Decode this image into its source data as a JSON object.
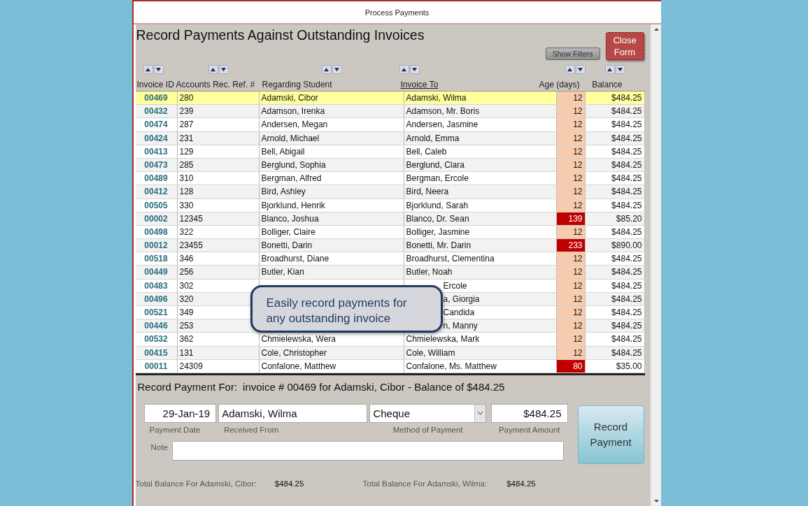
{
  "window": {
    "title": "Process Payments"
  },
  "form_title": "Record Payments Against Outstanding Invoices",
  "buttons": {
    "show_filters": "Show Filters",
    "close_form": "Close Form",
    "record_payment": "Record Payment"
  },
  "table": {
    "columns": [
      {
        "label": "Invoice ID",
        "underlined": false
      },
      {
        "label": "Accounts Rec. Ref. #",
        "underlined": false
      },
      {
        "label": "Regarding Student",
        "underlined": false
      },
      {
        "label": "Invoice To",
        "underlined": true
      },
      {
        "label": "Age (days)",
        "underlined": false
      },
      {
        "label": "Balance",
        "underlined": false
      }
    ],
    "rows": [
      {
        "invoice_id": "00469",
        "ref": "280",
        "student": "Adamski, Cibor",
        "invoice_to": "Adamski, Wilma",
        "age": "12",
        "overdue": false,
        "balance": "$484.25",
        "selected": true
      },
      {
        "invoice_id": "00432",
        "ref": "239",
        "student": "Adamson, Irenka",
        "invoice_to": "Adamson, Mr. Boris",
        "age": "12",
        "overdue": false,
        "balance": "$484.25",
        "selected": false
      },
      {
        "invoice_id": "00474",
        "ref": "287",
        "student": "Andersen, Megan",
        "invoice_to": "Andersen, Jasmine",
        "age": "12",
        "overdue": false,
        "balance": "$484.25",
        "selected": false
      },
      {
        "invoice_id": "00424",
        "ref": "231",
        "student": "Arnold, Michael",
        "invoice_to": "Arnold, Emma",
        "age": "12",
        "overdue": false,
        "balance": "$484.25",
        "selected": false
      },
      {
        "invoice_id": "00413",
        "ref": "129",
        "student": "Bell, Abigail",
        "invoice_to": "Bell, Caleb",
        "age": "12",
        "overdue": false,
        "balance": "$484.25",
        "selected": false
      },
      {
        "invoice_id": "00473",
        "ref": "285",
        "student": "Berglund, Sophia",
        "invoice_to": "Berglund, Clara",
        "age": "12",
        "overdue": false,
        "balance": "$484.25",
        "selected": false
      },
      {
        "invoice_id": "00489",
        "ref": "310",
        "student": "Bergman, Alfred",
        "invoice_to": "Bergman, Ercole",
        "age": "12",
        "overdue": false,
        "balance": "$484.25",
        "selected": false
      },
      {
        "invoice_id": "00412",
        "ref": "128",
        "student": "Bird, Ashley",
        "invoice_to": "Bird, Neera",
        "age": "12",
        "overdue": false,
        "balance": "$484.25",
        "selected": false
      },
      {
        "invoice_id": "00505",
        "ref": "330",
        "student": "Bjorklund, Henrik",
        "invoice_to": "Bjorklund, Sarah",
        "age": "12",
        "overdue": false,
        "balance": "$484.25",
        "selected": false
      },
      {
        "invoice_id": "00002",
        "ref": "12345",
        "student": "Blanco, Joshua",
        "invoice_to": "Blanco, Dr. Sean",
        "age": "139",
        "overdue": true,
        "balance": "$85.20",
        "selected": false
      },
      {
        "invoice_id": "00498",
        "ref": "322",
        "student": "Bolliger, Claire",
        "invoice_to": "Bolliger, Jasmine",
        "age": "12",
        "overdue": false,
        "balance": "$484.25",
        "selected": false
      },
      {
        "invoice_id": "00012",
        "ref": "23455",
        "student": "Bonetti, Darin",
        "invoice_to": "Bonetti, Mr. Darin",
        "age": "233",
        "overdue": true,
        "balance": "$890.00",
        "selected": false
      },
      {
        "invoice_id": "00518",
        "ref": "346",
        "student": "Broadhurst, Diane",
        "invoice_to": "Broadhurst, Clementina",
        "age": "12",
        "overdue": false,
        "balance": "$484.25",
        "selected": false
      },
      {
        "invoice_id": "00449",
        "ref": "256",
        "student": "Butler, Kian",
        "invoice_to": "Butler, Noah",
        "age": "12",
        "overdue": false,
        "balance": "$484.25",
        "selected": false
      },
      {
        "invoice_id": "00483",
        "ref": "302",
        "invoice_to": "Ercole",
        "age": "12",
        "overdue": false,
        "balance": "$484.25",
        "selected": false
      },
      {
        "invoice_id": "00496",
        "ref": "320",
        "invoice_to": "a, Giorgia",
        "age": "12",
        "overdue": false,
        "balance": "$484.25",
        "selected": false
      },
      {
        "invoice_id": "00521",
        "ref": "349",
        "invoice_to": "Candida",
        "age": "12",
        "overdue": false,
        "balance": "$484.25",
        "selected": false
      },
      {
        "invoice_id": "00446",
        "ref": "253",
        "invoice_to": "n, Manny",
        "age": "12",
        "overdue": false,
        "balance": "$484.25",
        "selected": false
      },
      {
        "invoice_id": "00532",
        "ref": "362",
        "student": "Chmielewska, Wera",
        "invoice_to": "Chmielewska, Mark",
        "age": "12",
        "overdue": false,
        "balance": "$484.25",
        "selected": false
      },
      {
        "invoice_id": "00415",
        "ref": "131",
        "student": "Cole, Christopher",
        "invoice_to": "Cole, William",
        "age": "12",
        "overdue": false,
        "balance": "$484.25",
        "selected": false
      },
      {
        "invoice_id": "00011",
        "ref": "24309",
        "student": "Confalone, Matthew",
        "invoice_to": "Confalone, Ms. Matthew",
        "age": "80",
        "overdue": true,
        "balance": "$35.00",
        "selected": false
      }
    ]
  },
  "callout": "Easily record payments for any outstanding invoice",
  "payment": {
    "heading": "Record Payment For:",
    "summary": "invoice # 00469 for Adamski, Cibor - Balance of $484.25",
    "fields": [
      {
        "label": "Payment Date",
        "value": "29-Jan-19",
        "kind": "right"
      },
      {
        "label": "Received From",
        "value": "Adamski, Wilma",
        "kind": "text"
      },
      {
        "label": "Method of Payment",
        "value": "Cheque",
        "kind": "dropdown"
      },
      {
        "label": "Payment Amount",
        "value": "$484.25",
        "kind": "right"
      }
    ],
    "note_label": "Note"
  },
  "totals": [
    {
      "label": "Total Balance For Adamski, Cibor:",
      "value": "$484.25"
    },
    {
      "label": "Total Balance For Adamski, Wilma:",
      "value": "$484.25"
    }
  ]
}
